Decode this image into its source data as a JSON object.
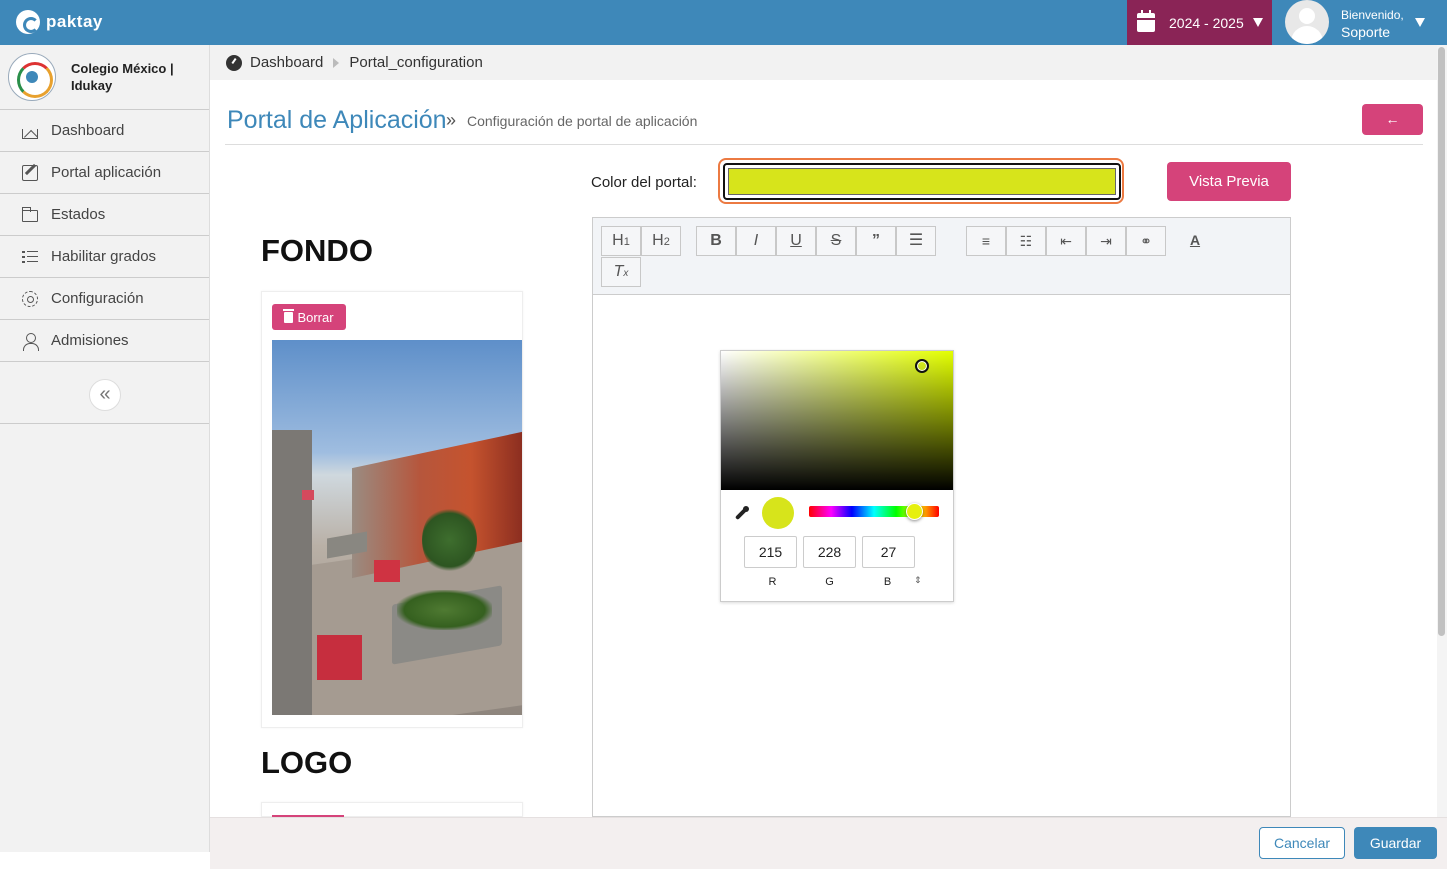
{
  "app": {
    "brand": "paktay"
  },
  "header": {
    "school_year": "2024 - 2025",
    "welcome": "Bienvenido,",
    "user_name": "Soporte"
  },
  "sidebar": {
    "school_name": "Colegio México | Idukay",
    "items": [
      {
        "label": "Dashboard",
        "icon": "home-icon"
      },
      {
        "label": "Portal aplicación",
        "icon": "edit-icon"
      },
      {
        "label": "Estados",
        "icon": "folder-icon"
      },
      {
        "label": "Habilitar grados",
        "icon": "list-icon"
      },
      {
        "label": "Configuración",
        "icon": "gear-icon"
      },
      {
        "label": "Admisiones",
        "icon": "user-icon"
      }
    ],
    "collapse_glyph": "«"
  },
  "breadcrumb": {
    "items": [
      "Dashboard",
      "Portal_configuration"
    ]
  },
  "page": {
    "title": "Portal de Aplicación",
    "separator": "»",
    "subtitle": "Configuración de portal de aplicación",
    "back_glyph": "←"
  },
  "form": {
    "color_label": "Color del portal:",
    "color_value": "#d7e41b",
    "preview_label": "Vista Previa"
  },
  "sections": {
    "fondo_title": "FONDO",
    "delete_label": "Borrar",
    "logo_title": "LOGO"
  },
  "editor": {
    "toolbar": [
      "H1",
      "H2",
      "B",
      "I",
      "U",
      "S",
      "quote",
      "hr",
      "ordered-list",
      "bullet-list",
      "outdent",
      "indent",
      "link",
      "text-color",
      "clear-format"
    ]
  },
  "color_picker": {
    "r": "215",
    "g": "228",
    "b": "27",
    "r_label": "R",
    "g_label": "G",
    "b_label": "B",
    "toggle_glyph": "⇕"
  },
  "footer": {
    "cancel_label": "Cancelar",
    "save_label": "Guardar"
  },
  "colors": {
    "brand": "#3e88b9",
    "accent": "#d5437a",
    "year_bg": "#8a2456",
    "selected_color": "#d7e41b"
  }
}
